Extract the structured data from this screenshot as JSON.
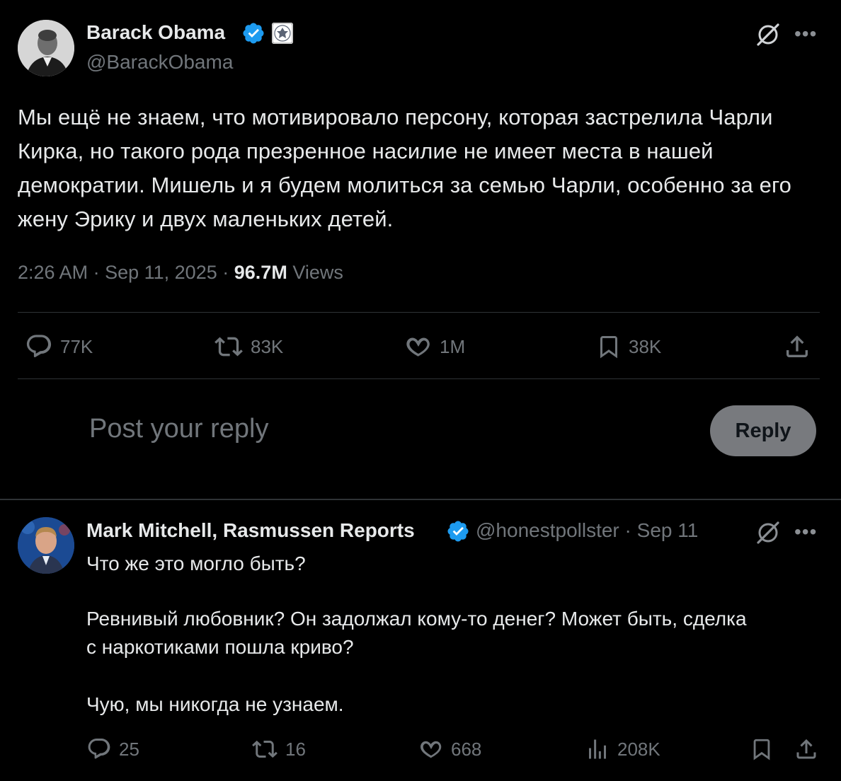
{
  "main_tweet": {
    "author_name": "Barack Obama",
    "handle": "@BarackObama",
    "text": "Мы ещё не знаем, что мотивировало персону, которая застрелила Чарли Кирка, но такого рода презренное насилие не имеет места в нашей демократии. Мишель и я будем молиться за семью Чарли, особенно за его жену Эрику и двух маленьких детей.",
    "time": "2:26 AM",
    "date": "Sep 11, 2025",
    "separator": "·",
    "views_count": "96.7M",
    "views_label": "Views",
    "stats": {
      "replies": "77K",
      "reposts": "83K",
      "likes": "1M",
      "bookmarks": "38K"
    }
  },
  "composer": {
    "placeholder": "Post your reply",
    "reply_button": "Reply"
  },
  "reply_tweet": {
    "author_name": "Mark Mitchell, Rasmussen Reports",
    "handle": "@honestpollster",
    "date": "· Sep 11",
    "lines": [
      "Что же это могло быть?",
      "Ревнивый любовник? Он задолжал кому-то денег? Может быть, сделка",
      "с наркотиками пошла криво?",
      "Чую, мы никогда не узнаем."
    ],
    "stats": {
      "replies": "25",
      "reposts": "16",
      "likes": "668",
      "views": "208K"
    }
  },
  "icons": {
    "verified": "verified-badge-icon",
    "seal": "government-seal-icon",
    "grok": "grok-icon",
    "more": "more-options-icon",
    "reply": "reply-icon",
    "repost": "repost-icon",
    "like": "heart-icon",
    "bookmark": "bookmark-icon",
    "share": "share-icon",
    "views": "views-chart-icon"
  },
  "colors": {
    "background": "#000000",
    "text": "#e7e9ea",
    "muted": "#71767b",
    "verified": "#1d9bf0",
    "divider": "#2f3336"
  }
}
